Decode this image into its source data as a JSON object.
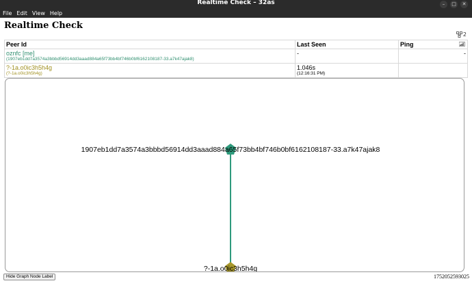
{
  "window": {
    "title": "Realtime Check – 32as"
  },
  "menu": [
    "File",
    "Edit",
    "View",
    "Help"
  ],
  "app": {
    "title": "Realtime Check",
    "peer_count": "2"
  },
  "table": {
    "headers": {
      "peer": "Peer Id",
      "last_seen": "Last Seen",
      "ping": "Ping"
    },
    "rows": [
      {
        "name": "oznfc [me]",
        "id": "(1907eb1dd7a3574a3bbbd56914dd3aaad884a65f73bb4bf746b0bf6162108187-33.a7k47ajak8)",
        "last_seen": "-",
        "last_seen_time": "",
        "ping": "-"
      },
      {
        "name": "?-1a.o0ic3h5h4g",
        "id": "(?-1a.o0ic3h5h4g)",
        "last_seen": "1.046s",
        "last_seen_time": "(12:16:31 PM)",
        "ping": ""
      }
    ]
  },
  "graph": {
    "nodes": [
      {
        "label": "1907eb1dd7a3574a3bbbd56914dd3aaad884a65f73bb4bf746b0bf6162108187-33.a7k47ajak8",
        "color": "#2e9a7c"
      },
      {
        "label": "?-1a.o0ic3h5h4g",
        "color": "#a8982c"
      }
    ],
    "edge_color": "#2e9a7c"
  },
  "footer": {
    "hide_label_button": "Hide Graph Node Label",
    "timestamp": "1752052593025"
  },
  "icons": {
    "peer_count": "network-icon",
    "ping": "signal-bars-icon"
  }
}
